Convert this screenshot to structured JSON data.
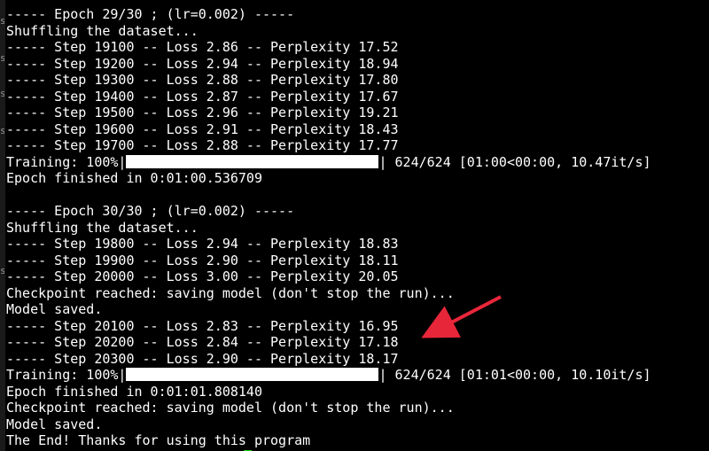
{
  "terminal": {
    "background": "#000000",
    "foreground": "#ffffff",
    "cursor_color": "#22cc22",
    "annotation_color": "#e8263a",
    "lines": [
      {
        "kind": "text",
        "text": "----- Epoch 29/30 ; (lr=0.002) -----"
      },
      {
        "kind": "text",
        "text": "Shuffling the dataset..."
      },
      {
        "kind": "text",
        "text": "----- Step 19100 -- Loss 2.86 -- Perplexity 17.52"
      },
      {
        "kind": "text",
        "text": "----- Step 19200 -- Loss 2.94 -- Perplexity 18.94"
      },
      {
        "kind": "text",
        "text": "----- Step 19300 -- Loss 2.88 -- Perplexity 17.80"
      },
      {
        "kind": "text",
        "text": "----- Step 19400 -- Loss 2.87 -- Perplexity 17.67"
      },
      {
        "kind": "text",
        "text": "----- Step 19500 -- Loss 2.96 -- Perplexity 19.21"
      },
      {
        "kind": "text",
        "text": "----- Step 19600 -- Loss 2.91 -- Perplexity 18.43"
      },
      {
        "kind": "text",
        "text": "----- Step 19700 -- Loss 2.88 -- Perplexity 17.77"
      },
      {
        "kind": "progress",
        "prefix": "Training: 100%|",
        "progress": 1.0,
        "suffix": "| 624/624 [01:00<00:00, 10.47it/s]"
      },
      {
        "kind": "text",
        "text": "Epoch finished in 0:01:00.536709"
      },
      {
        "kind": "text",
        "text": ""
      },
      {
        "kind": "text",
        "text": "----- Epoch 30/30 ; (lr=0.002) -----"
      },
      {
        "kind": "text",
        "text": "Shuffling the dataset..."
      },
      {
        "kind": "text",
        "text": "----- Step 19800 -- Loss 2.94 -- Perplexity 18.83"
      },
      {
        "kind": "text",
        "text": "----- Step 19900 -- Loss 2.90 -- Perplexity 18.11"
      },
      {
        "kind": "text",
        "text": "----- Step 20000 -- Loss 3.00 -- Perplexity 20.05"
      },
      {
        "kind": "text",
        "text": "Checkpoint reached: saving model (don't stop the run)..."
      },
      {
        "kind": "text",
        "text": "Model saved."
      },
      {
        "kind": "text",
        "text": "----- Step 20100 -- Loss 2.83 -- Perplexity 16.95"
      },
      {
        "kind": "text",
        "text": "----- Step 20200 -- Loss 2.84 -- Perplexity 17.18"
      },
      {
        "kind": "text",
        "text": "----- Step 20300 -- Loss 2.90 -- Perplexity 18.17"
      },
      {
        "kind": "progress",
        "prefix": "Training: 100%|",
        "progress": 1.0,
        "suffix": "| 624/624 [01:01<00:00, 10.10it/s]"
      },
      {
        "kind": "text",
        "text": "Epoch finished in 0:01:01.808140"
      },
      {
        "kind": "text",
        "text": "Checkpoint reached: saving model (don't stop the run)..."
      },
      {
        "kind": "text",
        "text": "Model saved."
      },
      {
        "kind": "text",
        "text": "The End! Thanks for using this program"
      }
    ]
  }
}
